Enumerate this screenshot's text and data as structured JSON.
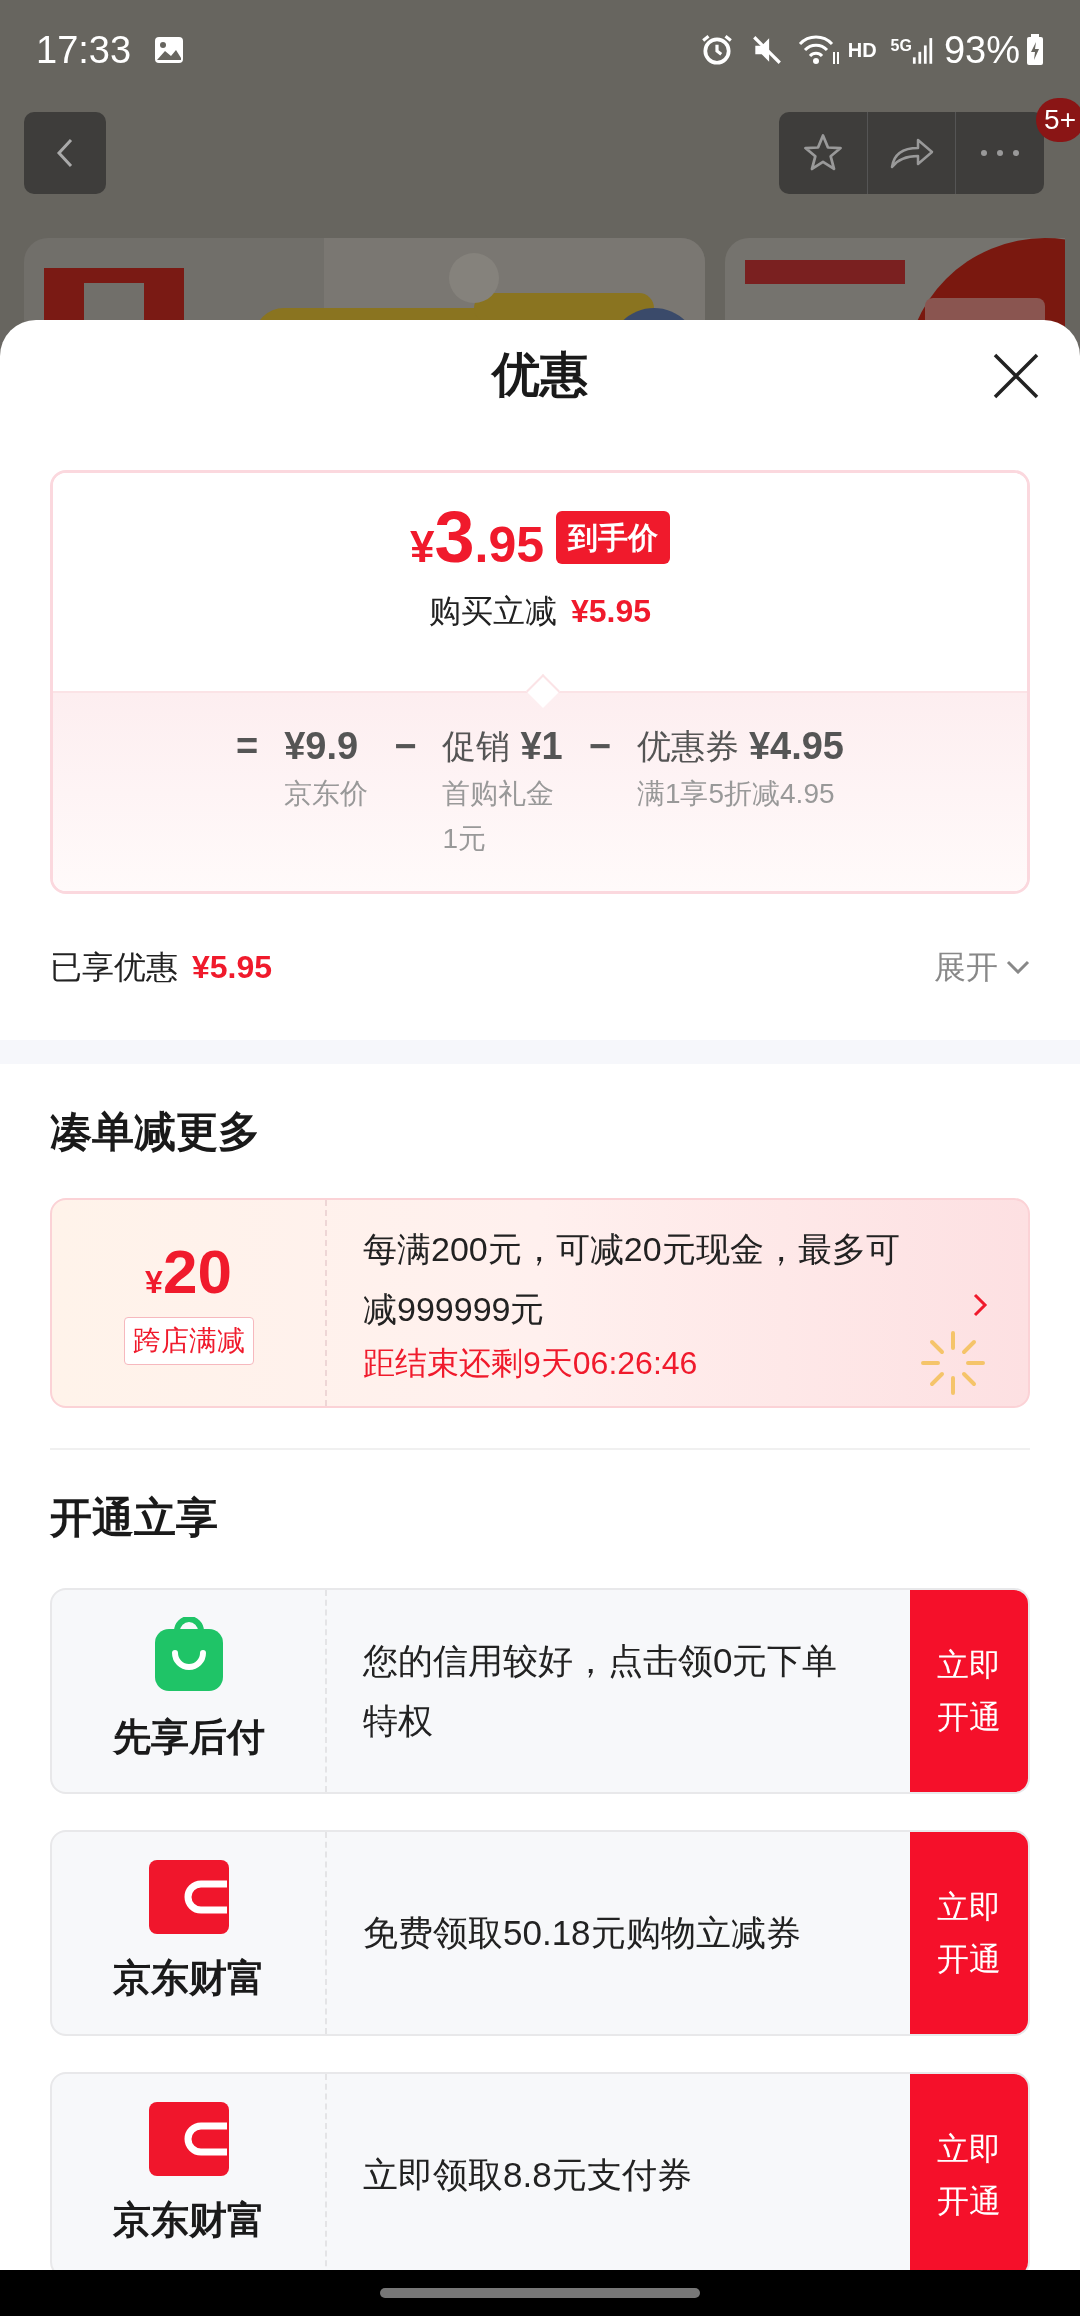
{
  "status_bar": {
    "time": "17:33",
    "network_hd": "HD",
    "network_type": "5G",
    "battery": "93%"
  },
  "top_nav": {
    "badge": "5+"
  },
  "sheet": {
    "title": "优惠",
    "price_card": {
      "price_symbol": "¥",
      "price_integer": "3",
      "price_decimal": ".95",
      "price_tag": "到手价",
      "saving_label": "购买立减",
      "saving_amount": "¥5.95",
      "breakdown": [
        {
          "operator": "=",
          "amount": "¥9.9",
          "note": "京东价"
        },
        {
          "operator": "−",
          "label": "促销",
          "amount": "¥1",
          "note": "首购礼金1元"
        },
        {
          "operator": "−",
          "label": "优惠券",
          "amount": "¥4.95",
          "note": "满1享5折减4.95"
        }
      ]
    },
    "enjoyed": {
      "label": "已享优惠",
      "amount": "¥5.95",
      "expand": "展开"
    },
    "bundle": {
      "heading": "凑单减更多",
      "coupon": {
        "symbol": "¥",
        "value": "20",
        "tag": "跨店满减",
        "description": "每满200元，可减20元现金，最多可减999999元",
        "countdown": "距结束还剩9天06:26:46"
      }
    },
    "activate": {
      "heading": "开通立享",
      "offers": [
        {
          "kind": "bag",
          "brand": "先享后付",
          "text": "您的信用较好，点击领0元下单特权",
          "button": "立即开通"
        },
        {
          "kind": "wallet",
          "brand": "京东财富",
          "text": "免费领取50.18元购物立减券",
          "button": "立即开通"
        },
        {
          "kind": "wallet",
          "brand": "京东财富",
          "text": "立即领取8.8元支付券",
          "button": "立即开通"
        }
      ]
    }
  }
}
